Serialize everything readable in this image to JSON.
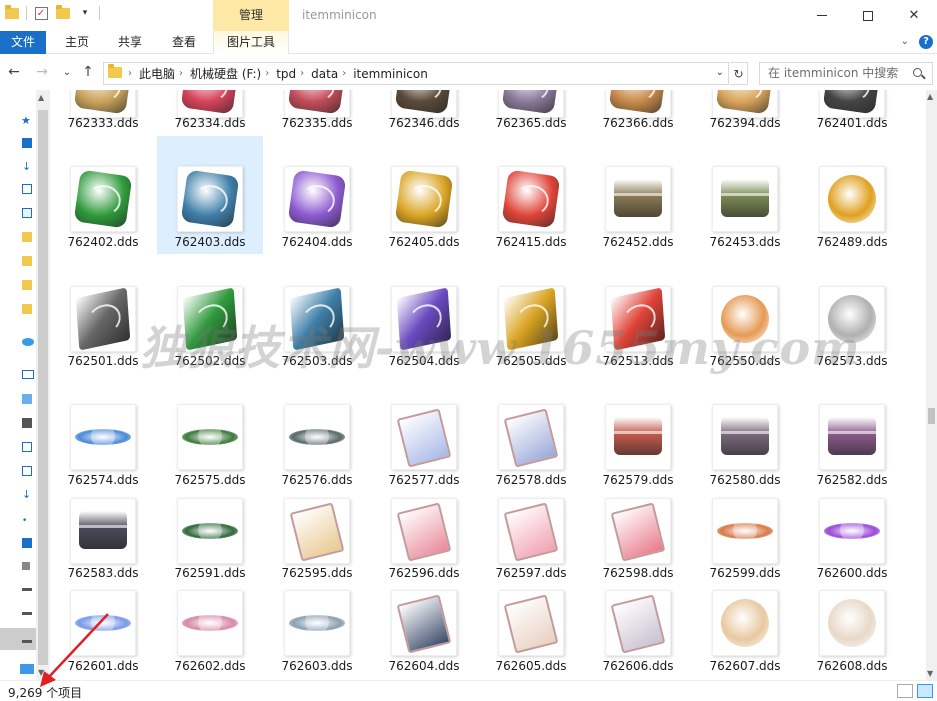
{
  "window": {
    "title": "itemminicon",
    "context_group": "管理",
    "minimize": "—",
    "maximize": "□",
    "close": "✕"
  },
  "ribbon": {
    "tabs": [
      "文件",
      "主页",
      "共享",
      "查看",
      "图片工具"
    ],
    "expand_glyph": "⌄",
    "help_glyph": "?"
  },
  "address": {
    "back": "←",
    "forward": "→",
    "recent": "⌄",
    "up": "↑",
    "crumbs": [
      "此电脑",
      "机械硬盘 (F:)",
      "tpd",
      "data",
      "itemminicon"
    ],
    "search_placeholder": "在 itemminicon 中搜索"
  },
  "files": [
    {
      "name": "762333.dds",
      "kind": "partial",
      "color": "#c9a35a"
    },
    {
      "name": "762334.dds",
      "kind": "partial",
      "color": "#d6435a"
    },
    {
      "name": "762335.dds",
      "kind": "partial",
      "color": "#c44c5a"
    },
    {
      "name": "762346.dds",
      "kind": "partial",
      "color": "#5a4a3a"
    },
    {
      "name": "762365.dds",
      "kind": "partial",
      "color": "#8a7a9a"
    },
    {
      "name": "762366.dds",
      "kind": "partial",
      "color": "#c98a4a"
    },
    {
      "name": "762394.dds",
      "kind": "partial",
      "color": "#d9a55a"
    },
    {
      "name": "762401.dds",
      "kind": "partial",
      "color": "#444"
    },
    {
      "name": "762402.dds",
      "kind": "gem",
      "color": "#2f9a3c"
    },
    {
      "name": "762403.dds",
      "kind": "gem",
      "color": "#3f7fa8"
    },
    {
      "name": "762404.dds",
      "kind": "gem",
      "color": "#8d5ad1"
    },
    {
      "name": "762405.dds",
      "kind": "gem",
      "color": "#d9a422"
    },
    {
      "name": "762415.dds",
      "kind": "gem",
      "color": "#e04438"
    },
    {
      "name": "762452.dds",
      "kind": "chest",
      "color": "#8a7a54"
    },
    {
      "name": "762453.dds",
      "kind": "chest",
      "color": "#7a8a54"
    },
    {
      "name": "762489.dds",
      "kind": "orb",
      "color": "#e0a020"
    },
    {
      "name": "762501.dds",
      "kind": "shard",
      "color": "#666"
    },
    {
      "name": "762502.dds",
      "kind": "shard",
      "color": "#2f9a3c"
    },
    {
      "name": "762503.dds",
      "kind": "shard",
      "color": "#3f7fa8"
    },
    {
      "name": "762504.dds",
      "kind": "shard",
      "color": "#6a4ac1"
    },
    {
      "name": "762505.dds",
      "kind": "shard",
      "color": "#d9a422"
    },
    {
      "name": "762513.dds",
      "kind": "shard",
      "color": "#e04438"
    },
    {
      "name": "762550.dds",
      "kind": "orb",
      "color": "#e69a55"
    },
    {
      "name": "762573.dds",
      "kind": "orb",
      "color": "#b0b0b0"
    },
    {
      "name": "762574.dds",
      "kind": "banner",
      "color": "#4a8ad8"
    },
    {
      "name": "762575.dds",
      "kind": "banner",
      "color": "#3c7a3c"
    },
    {
      "name": "762576.dds",
      "kind": "banner",
      "color": "#5a6a6a"
    },
    {
      "name": "762577.dds",
      "kind": "card",
      "color": "#a8b8e8"
    },
    {
      "name": "762578.dds",
      "kind": "card",
      "color": "#9aa8d8"
    },
    {
      "name": "762579.dds",
      "kind": "chest",
      "color": "#c05a4a"
    },
    {
      "name": "762580.dds",
      "kind": "chest",
      "color": "#7a6a7a"
    },
    {
      "name": "762582.dds",
      "kind": "chest",
      "color": "#8a5a8a"
    },
    {
      "name": "762583.dds",
      "kind": "chest",
      "color": "#4a4a5a"
    },
    {
      "name": "762591.dds",
      "kind": "banner",
      "color": "#2f6a3c"
    },
    {
      "name": "762595.dds",
      "kind": "card",
      "color": "#e8c890"
    },
    {
      "name": "762596.dds",
      "kind": "card",
      "color": "#e88a9a"
    },
    {
      "name": "762597.dds",
      "kind": "card",
      "color": "#f0a0b0"
    },
    {
      "name": "762598.dds",
      "kind": "card",
      "color": "#e87a8a"
    },
    {
      "name": "762599.dds",
      "kind": "banner",
      "color": "#d87a4a"
    },
    {
      "name": "762600.dds",
      "kind": "banner",
      "color": "#9a4ad8"
    },
    {
      "name": "762601.dds",
      "kind": "banner",
      "color": "#7a9ae8"
    },
    {
      "name": "762602.dds",
      "kind": "banner",
      "color": "#d88aa8"
    },
    {
      "name": "762603.dds",
      "kind": "banner",
      "color": "#8aa0b0"
    },
    {
      "name": "762604.dds",
      "kind": "card",
      "color": "#3a4a6a"
    },
    {
      "name": "762605.dds",
      "kind": "card",
      "color": "#e8d0c0"
    },
    {
      "name": "762606.dds",
      "kind": "card",
      "color": "#c8c0d0"
    },
    {
      "name": "762607.dds",
      "kind": "orb",
      "color": "#e8c8a0"
    },
    {
      "name": "762608.dds",
      "kind": "orb",
      "color": "#e8d8c8"
    }
  ],
  "selected_file": "762403.dds",
  "watermark": "独狼技术网-www.1655my.com",
  "status": {
    "count": "9,269 个项目"
  },
  "colors": {
    "accent": "#1a6fc9",
    "context_group": "#fde8a6",
    "selection": "#ddefff",
    "annotation_arrow": "#e02020"
  }
}
